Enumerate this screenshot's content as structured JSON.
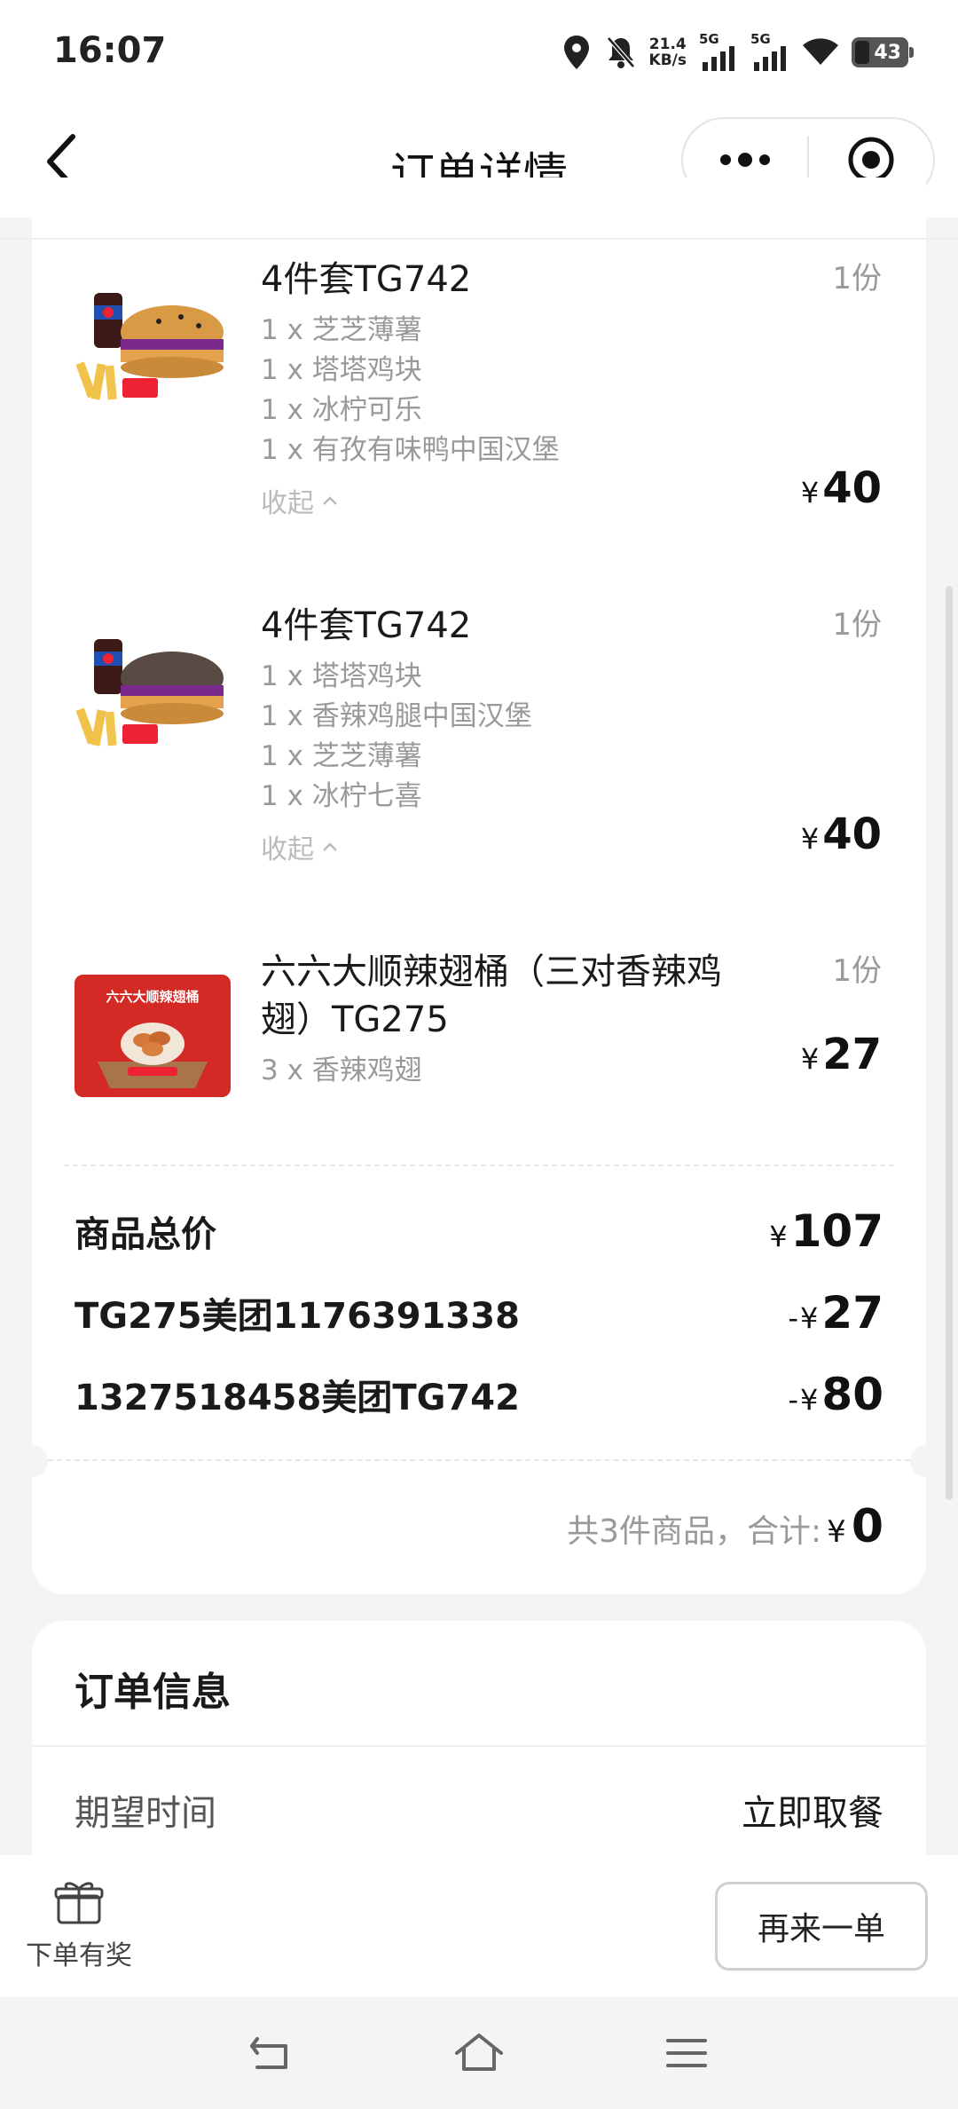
{
  "status_bar": {
    "time": "16:07",
    "net_speed_value": "21.4",
    "net_speed_unit": "KB/s",
    "signal1": "5G",
    "signal2": "5G",
    "battery": "43"
  },
  "header": {
    "title": "订单详情"
  },
  "items": [
    {
      "name": "4件套TG742",
      "qty": "1份",
      "subs": [
        "1 x 芝芝薄薯",
        "1 x 塔塔鸡块",
        "1 x 冰柠可乐",
        "1 x 有孜有味鸭中国汉堡"
      ],
      "collapse": "收起",
      "yen": "¥",
      "price": "40"
    },
    {
      "name": "4件套TG742",
      "qty": "1份",
      "subs": [
        "1 x 塔塔鸡块",
        "1 x 香辣鸡腿中国汉堡",
        "1 x 芝芝薄薯",
        "1 x 冰柠七喜"
      ],
      "collapse": "收起",
      "yen": "¥",
      "price": "40"
    },
    {
      "name_line1": "六六大顺辣翅桶（三对香辣鸡",
      "name_line2": "翅）TG275",
      "qty": "1份",
      "subs": [
        "3 x 香辣鸡翅"
      ],
      "yen": "¥",
      "price": "27",
      "image_text": "六六大顺辣翅桶"
    }
  ],
  "summary": {
    "goods_total_label": "商品总价",
    "goods_total_yen": "¥",
    "goods_total_value": "107",
    "discount1_label": "TG275美团1176391338",
    "discount1_prefix": "-",
    "discount1_yen": "¥",
    "discount1_value": "27",
    "discount2_label": "1327518458美团TG742",
    "discount2_prefix": "-",
    "discount2_yen": "¥",
    "discount2_value": "80",
    "total_label": "共3件商品，合计:",
    "total_yen": "¥",
    "total_value": "0"
  },
  "order_info": {
    "title": "订单信息",
    "rows": [
      {
        "key": "期望时间",
        "value": "立即取餐"
      }
    ]
  },
  "bottom_bar": {
    "reward_label": "下单有奖",
    "reorder_label": "再来一单"
  }
}
